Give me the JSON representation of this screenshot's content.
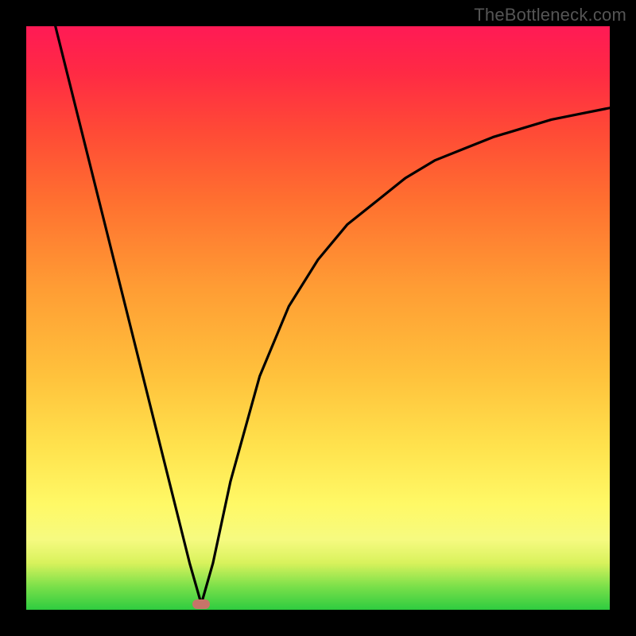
{
  "watermark": "TheBottleneck.com",
  "colors": {
    "frame": "#000000",
    "curve": "#000000",
    "marker": "#c77469"
  },
  "chart_data": {
    "type": "line",
    "title": "",
    "xlabel": "",
    "ylabel": "",
    "xlim": [
      0,
      100
    ],
    "ylim": [
      0,
      100
    ],
    "grid": false,
    "legend": false,
    "minimum_point": {
      "x": 30,
      "y": 1
    },
    "series": [
      {
        "name": "left-branch",
        "x": [
          5,
          10,
          15,
          20,
          25,
          28,
          30
        ],
        "y": [
          100,
          80,
          60,
          40,
          20,
          8,
          1
        ]
      },
      {
        "name": "right-branch",
        "x": [
          30,
          32,
          35,
          40,
          45,
          50,
          55,
          60,
          65,
          70,
          75,
          80,
          85,
          90,
          95,
          100
        ],
        "y": [
          1,
          8,
          22,
          40,
          52,
          60,
          66,
          70,
          74,
          77,
          79,
          81,
          82.5,
          84,
          85,
          86
        ]
      }
    ]
  }
}
